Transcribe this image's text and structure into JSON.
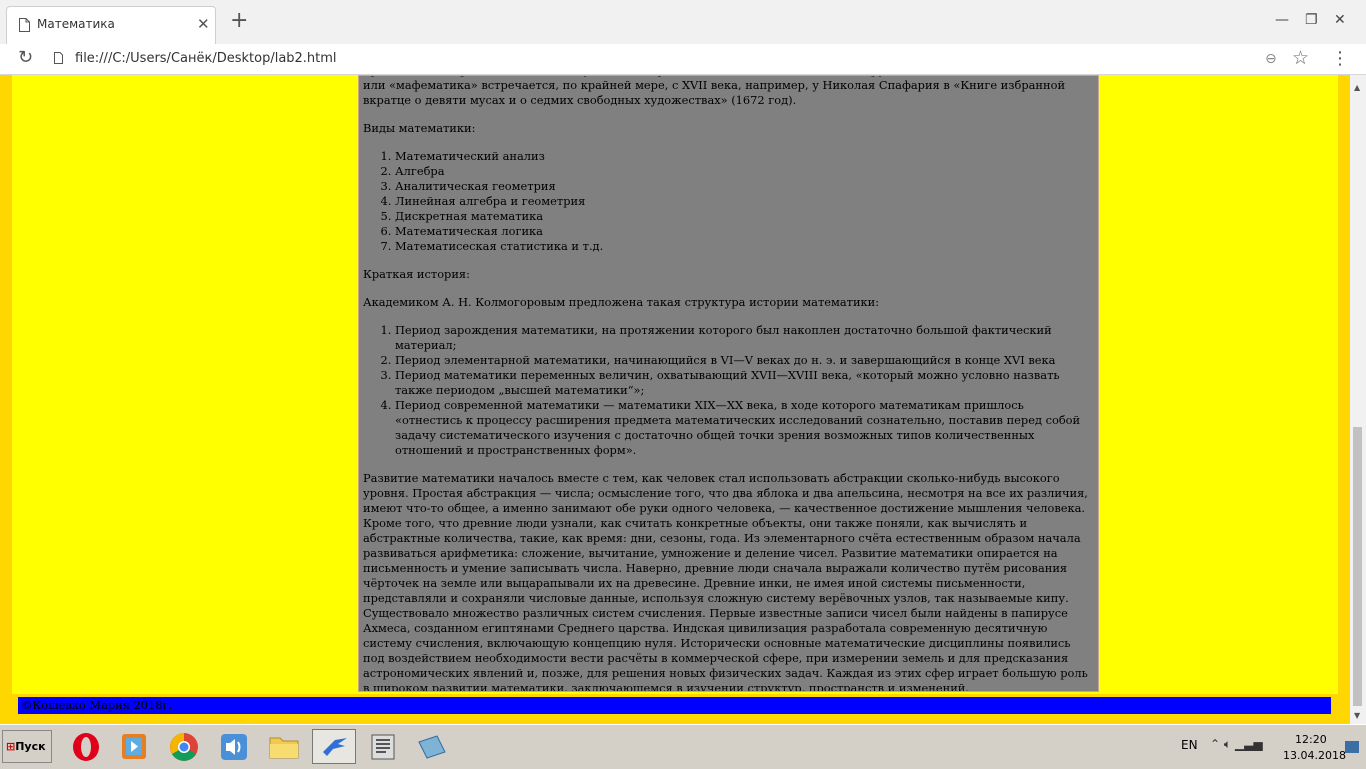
{
  "browser": {
    "tab_title": "Математика",
    "url": "file:///C:/Users/Санёк/Desktop/lab2.html"
  },
  "page": {
    "intro_partial": "пришло либо через польск. matematyka, либо через лат. mathematica. В текстах на русском языке слово «математика» или «мафематика» встречается, по крайней мере, с XVII века, например, у Николая Спафария в «Книге избранной вкратце о девяти мусах и о седмих свободных художествах» (1672 год).",
    "types_heading": "Виды математики:",
    "types": [
      "Математический анализ",
      "Алгебра",
      "Аналитическая геометрия",
      "Линейная алгебра и геометрия",
      "Дискретная математика",
      "Математическая логика",
      "Математисеская статистика и т.д."
    ],
    "history_heading": "Краткая история:",
    "history_intro": "Академиком А. Н. Колмогоровым предложена такая структура истории математики:",
    "periods": [
      "Период зарождения математики, на протяжении которого был накоплен достаточно большой фактический материал;",
      "Период элементарной математики, начинающийся в VI—V веках до н. э. и завершающийся в конце XVI века",
      "Период математики переменных величин, охватывающий XVII—XVIII века, «который можно условно назвать также периодом „высшей математики“»;",
      "Период современной математики — математики XIX—XX века, в ходе которого математикам пришлось «отнестись к процессу расширения предмета математических исследований сознательно, поставив перед собой задачу систематического изучения с достаточно общей точки зрения возможных типов количественных отношений и пространственных форм»."
    ],
    "development": "Развитие математики началось вместе с тем, как человек стал использовать абстракции сколько-нибудь высокого уровня. Простая абстракция — числа; осмысление того, что два яблока и два апельсина, несмотря на все их различия, имеют что-то общее, а именно занимают обе руки одного человека, — качественное достижение мышления человека. Кроме того, что древние люди узнали, как считать конкретные объекты, они также поняли, как вычислять и абстрактные количества, такие, как время: дни, сезоны, года. Из элементарного счёта естественным образом начала развиваться арифметика: сложение, вычитание, умножение и деление чисел. Развитие математики опирается на письменность и умение записывать числа. Наверно, древние люди сначала выражали количество путём рисования чёрточек на земле или выцарапывали их на древесине. Древние инки, не имея иной системы письменности, представляли и сохраняли числовые данные, используя сложную систему верёвочных узлов, так называемые кипу. Существовало множество различных систем счисления. Первые известные записи чисел были найдены в папирусе Ахмеса, созданном египтянами Среднего царства. Индская цивилизация разработала современную десятичную систему счисления, включающую концепцию нуля. Исторически основные математические дисциплины появились под воздействием необходимости вести расчёты в коммерческой сфере, при измерении земель и для предсказания астрономических явлений и, позже, для решения новых физических задач. Каждая из этих сфер играет большую роль в широком развитии математики, заключающемся в изучении структур, пространств и изменений.",
    "footer": "©Кошевко Мария 2018г."
  },
  "taskbar": {
    "start_label": "Пуск",
    "apps": [
      "Opera",
      "Media Player",
      "Chrome",
      "Volume",
      "Explorer",
      "App",
      "Documents",
      "Notepad"
    ],
    "lang": "EN",
    "time": "12:20",
    "date": "13.04.2018"
  },
  "colors": {
    "page_bg": "#ffff00",
    "content_bg": "#808080",
    "footer_bg": "#0000ff"
  }
}
